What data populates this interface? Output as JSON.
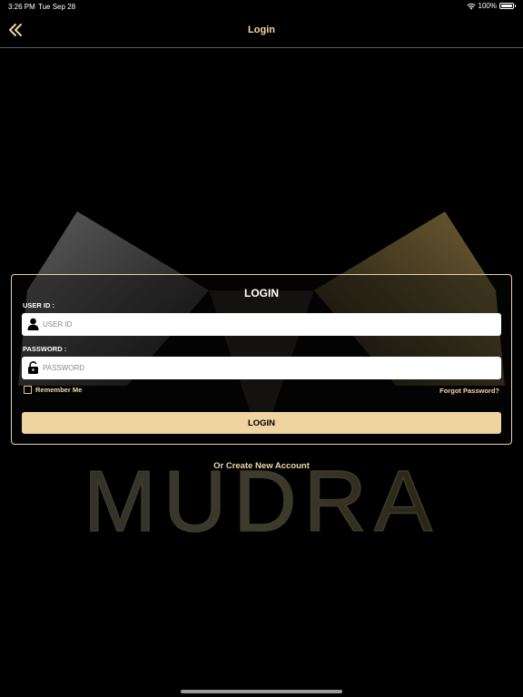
{
  "status": {
    "time": "3:26 PM",
    "date": "Tue Sep 28",
    "battery": "100%"
  },
  "nav": {
    "back_icon": "double-chevron-left-icon",
    "title": "Login"
  },
  "brand": {
    "logo_text": "MUDRA"
  },
  "form": {
    "title": "LOGIN",
    "user_label": "USER ID :",
    "user_placeholder": "USER ID",
    "user_value": "",
    "password_label": "PASSWORD :",
    "password_placeholder": "PASSWORD",
    "password_value": "",
    "remember_label": "Remember Me",
    "remember_checked": false,
    "forgot_label": "Forgot Password?",
    "submit_label": "LOGIN"
  },
  "footer": {
    "create_account_label": "Or Create New Account"
  },
  "colors": {
    "accent": "#efd4a0",
    "text_accent": "#f2d9a6",
    "background": "#000000"
  }
}
